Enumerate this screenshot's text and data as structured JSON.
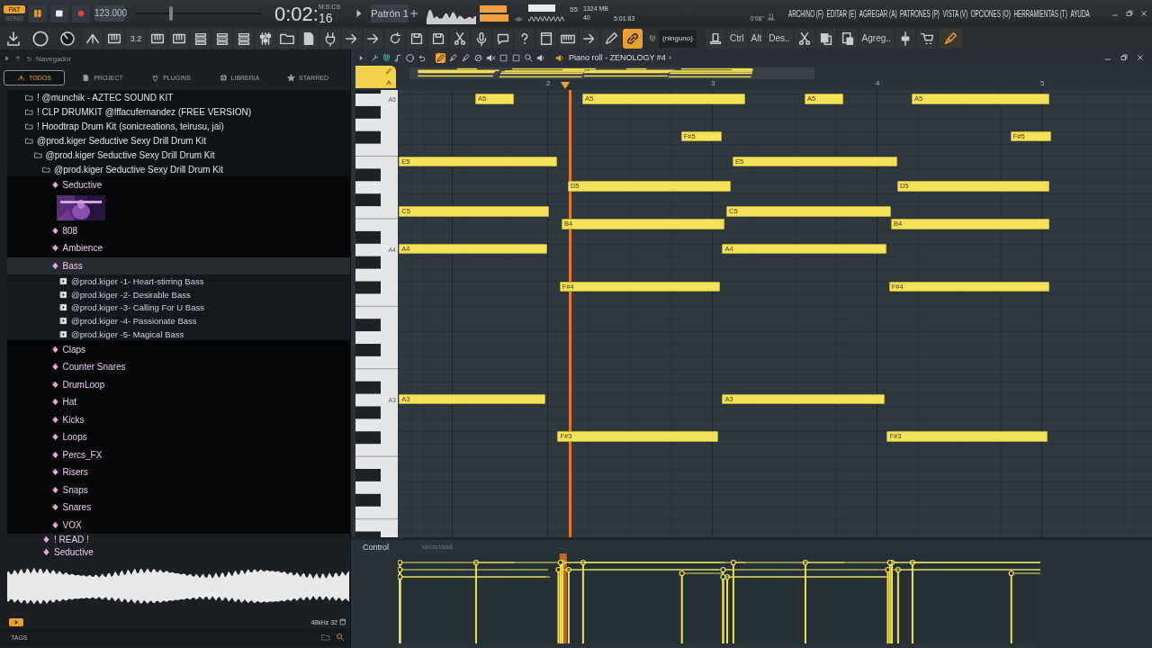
{
  "transport": {
    "modes": [
      {
        "label": "PAT",
        "selected": true
      },
      {
        "label": "SONG",
        "selected": false
      }
    ],
    "playing": true,
    "tempo": "123.000",
    "time": "0:02:",
    "time_unit": "M:S:CS",
    "time_cs": "16",
    "pattern": "Patrón 1",
    "pitch": {
      "level": 0.27
    }
  },
  "monitor": {
    "cpu": "55",
    "memory": "1324 MB",
    "polyphony": "40",
    "elapsed": "5:01:83",
    "hint": "0'08\""
  },
  "menu": [
    "ARCHINO (F)",
    "EDITAR (E)",
    "AGREGAR (A)",
    "PATRONES (P)",
    "VISTA (V)",
    "OPCIONES (O)",
    "HERRAMIENTAS (T)",
    "AYUDA"
  ],
  "toolbar": {
    "step_label": "3.2",
    "link_on": true,
    "snap": "(ninguno)",
    "buttons": [
      "Ctrl",
      "Alt",
      "Des..",
      "Agreg.."
    ]
  },
  "browser": {
    "title": "Navegador",
    "tabs": [
      {
        "label": "TODOS",
        "selected": true
      },
      {
        "label": "PROJECT",
        "selected": false
      },
      {
        "label": "PLUGINS",
        "selected": false
      },
      {
        "label": "LIBRERIA",
        "selected": false
      },
      {
        "label": "STARRED",
        "selected": false
      }
    ],
    "tree": [
      {
        "label": "! @munchik - AZTEC SOUND KIT",
        "kind": "folder",
        "selected": false
      },
      {
        "label": "! CLP DRUMKIT @lffacufernandez (FREE VERSION)",
        "kind": "folder",
        "selected": false
      },
      {
        "label": "! Hoodtrap Drum Kit (sonicreations, teirusu, jai)",
        "kind": "folder",
        "selected": false
      },
      {
        "label": "@prod.kiger Seductive Sexy Drill Drum Kit",
        "kind": "folder",
        "selected": false,
        "children": [
          {
            "label": "@prod.kiger Seductive Sexy Drill Drum Kit",
            "kind": "folder",
            "selected": false,
            "children": [
              {
                "label": "@prod.kiger Seductive Sexy Drill Drum Kit",
                "kind": "folder",
                "selected": false,
                "children": [
                  {
                    "label": "Seductive",
                    "kind": "category",
                    "selected": false
                  },
                  {
                    "kind": "picture",
                    "selected": false
                  },
                  {
                    "label": "808",
                    "kind": "category",
                    "selected": false
                  },
                  {
                    "label": "Ambience",
                    "kind": "category",
                    "selected": false
                  },
                  {
                    "label": "Bass",
                    "kind": "category",
                    "selected": true,
                    "children": [
                      {
                        "label": "@prod.kiger -1- Heart-stirring Bass",
                        "kind": "file",
                        "selected": false
                      },
                      {
                        "label": "@prod.kiger -2- Desirable Bass",
                        "kind": "file",
                        "selected": false
                      },
                      {
                        "label": "@prod.kiger -3- Calling For U Bass",
                        "kind": "file",
                        "selected": false
                      },
                      {
                        "label": "@prod.kiger -4- Passionate Bass",
                        "kind": "file",
                        "selected": false
                      },
                      {
                        "label": "@prod.kiger -5- Magical Bass",
                        "kind": "file",
                        "selected": false
                      }
                    ]
                  },
                  {
                    "label": "Claps",
                    "kind": "category",
                    "selected": false
                  },
                  {
                    "label": "Counter Snares",
                    "kind": "category",
                    "selected": false
                  },
                  {
                    "label": "DrumLoop",
                    "kind": "category",
                    "selected": false
                  },
                  {
                    "label": "Hat",
                    "kind": "category",
                    "selected": false
                  },
                  {
                    "label": "Kicks",
                    "kind": "category",
                    "selected": false
                  },
                  {
                    "label": "Loops",
                    "kind": "category",
                    "selected": false
                  },
                  {
                    "label": "Percs_FX",
                    "kind": "category",
                    "selected": false
                  },
                  {
                    "label": "Risers",
                    "kind": "category",
                    "selected": false
                  },
                  {
                    "label": "Snaps",
                    "kind": "category",
                    "selected": false
                  },
                  {
                    "label": "Snares",
                    "kind": "category",
                    "selected": false
                  },
                  {
                    "label": "VOX",
                    "kind": "category",
                    "selected": false
                  }
                ]
              },
              {
                "label": "! READ !",
                "kind": "item",
                "selected": false
              },
              {
                "label": "Seductive",
                "kind": "item",
                "selected": false
              }
            ]
          }
        ]
      }
    ],
    "sample_format": "48kHz 32",
    "tags_label": "TAGS"
  },
  "piano_roll": {
    "title": "Piano roll - ZENOLOGY #4",
    "tools": [
      {
        "selected": true
      },
      {
        "selected": false
      },
      {
        "selected": false
      },
      {
        "selected": false
      },
      {
        "selected": false
      },
      {
        "selected": false
      },
      {
        "selected": false
      },
      {
        "selected": false
      },
      {
        "selected": false
      }
    ],
    "bars": [
      "2",
      "3",
      "4",
      "5"
    ],
    "key_labels": [
      "A5",
      "A4",
      "A3"
    ],
    "notes": [
      {
        "pitch": "A5"
      },
      {
        "pitch": "A5"
      },
      {
        "pitch": "A5"
      },
      {
        "pitch": "A5"
      },
      {
        "pitch": "F#5"
      },
      {
        "pitch": "F#5"
      },
      {
        "pitch": "E5"
      },
      {
        "pitch": "E5"
      },
      {
        "pitch": "D5"
      },
      {
        "pitch": "D5"
      },
      {
        "pitch": "C5"
      },
      {
        "pitch": "C5"
      },
      {
        "pitch": "B4"
      },
      {
        "pitch": "B4"
      },
      {
        "pitch": "A4"
      },
      {
        "pitch": "A4"
      },
      {
        "pitch": "F#4"
      },
      {
        "pitch": "F#4"
      },
      {
        "pitch": "A3"
      },
      {
        "pitch": "A3"
      },
      {
        "pitch": "F#3"
      },
      {
        "pitch": "F#3"
      }
    ],
    "control": {
      "label": "Control",
      "parameter": "Velocidad"
    }
  }
}
